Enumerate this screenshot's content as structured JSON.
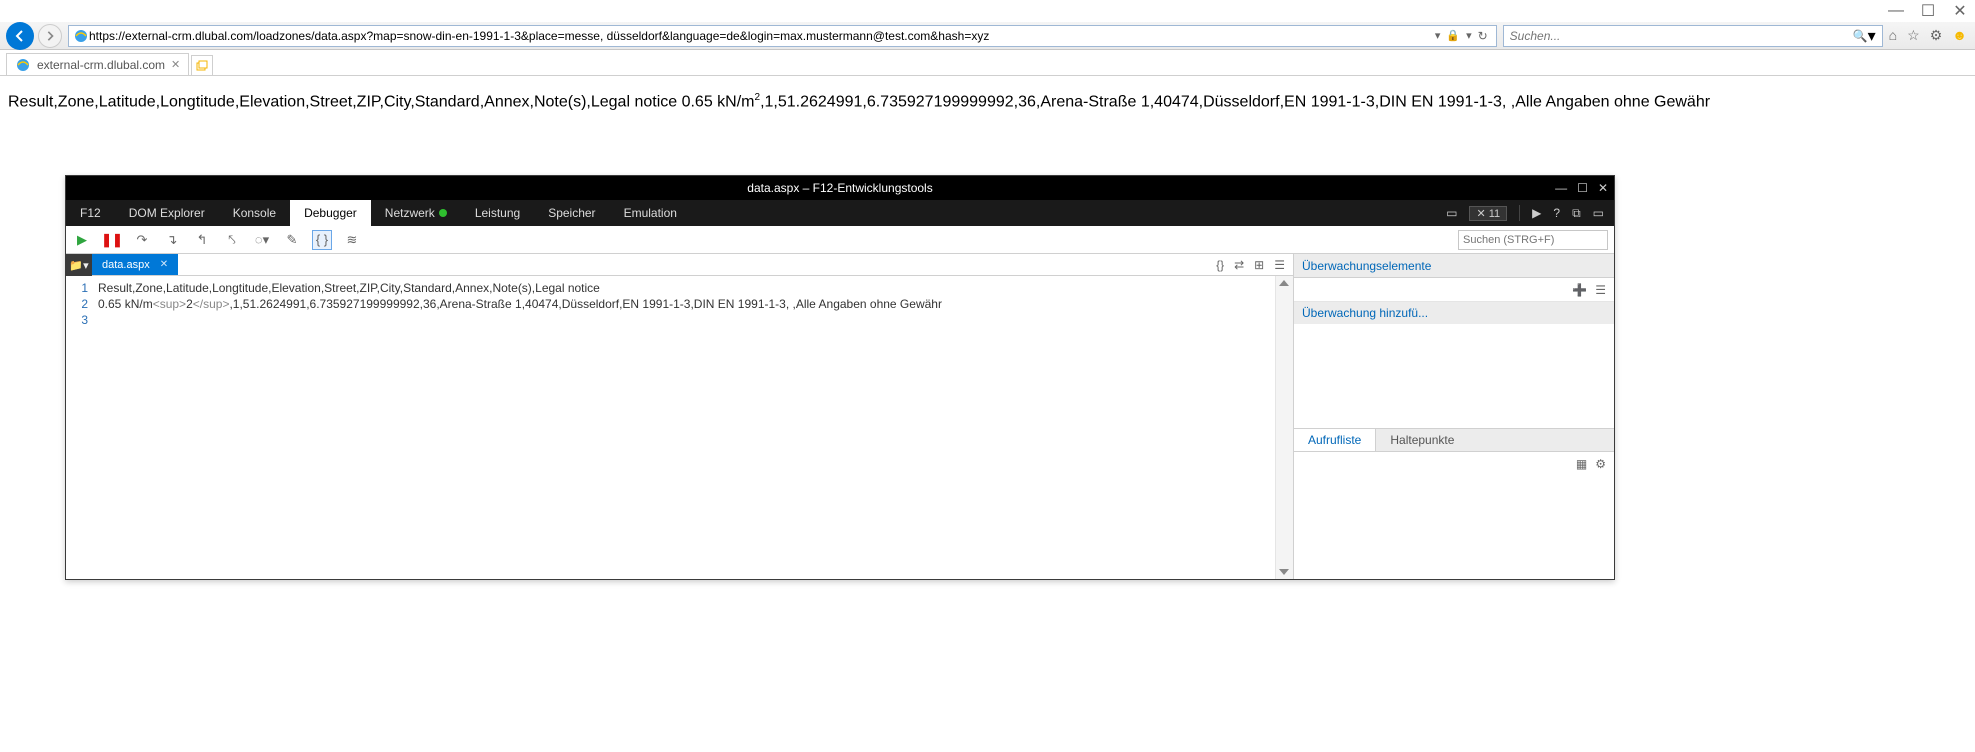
{
  "window": {
    "minimize": "—",
    "maximize": "☐",
    "close": "✕"
  },
  "url": "https://external-crm.dlubal.com/loadzones/data.aspx?map=snow-din-en-1991-1-3&place=messe, düsseldorf&language=de&login=max.mustermann@test.com&hash=xyz",
  "search": {
    "placeholder": "Suchen...",
    "dropdown": "▾"
  },
  "tab": {
    "title": "external-crm.dlubal.com"
  },
  "page_text_prefix": "Result,Zone,Latitude,Longtitude,Elevation,Street,ZIP,City,Standard,Annex,Note(s),Legal notice 0.65 kN/m",
  "page_text_sup": "2",
  "page_text_suffix": ",1,51.2624991,6.735927199999992,36,Arena-Straße 1,40474,Düsseldorf,EN 1991-1-3,DIN EN 1991-1-3, ,Alle Angaben ohne Gewähr",
  "devtools": {
    "title": "data.aspx – F12-Entwicklungstools",
    "tabs": {
      "f12": "F12",
      "dom": "DOM Explorer",
      "console": "Konsole",
      "debugger": "Debugger",
      "network": "Netzwerk",
      "perf": "Leistung",
      "memory": "Speicher",
      "emulation": "Emulation"
    },
    "error_count": "11",
    "toolbar_search": "Suchen (STRG+F)",
    "file_tab": "data.aspx",
    "code": {
      "line1": "Result,Zone,Latitude,Longtitude,Elevation,Street,ZIP,City,Standard,Annex,Note(s),Legal notice",
      "line2a": "0.65 kN/m",
      "line2b": "<sup>",
      "line2c": "2",
      "line2d": "</sup>",
      "line2e": ",1,51.2624991,6.735927199999992,36,Arena-Straße 1,40474,Düsseldorf,EN 1991-1-3,DIN EN 1991-1-3, ,Alle Angaben ohne Gewähr"
    },
    "watch": {
      "header": "Überwachungselemente",
      "add": "Überwachung hinzufü..."
    },
    "callstack": {
      "tab1": "Aufrufliste",
      "tab2": "Haltepunkte"
    }
  }
}
